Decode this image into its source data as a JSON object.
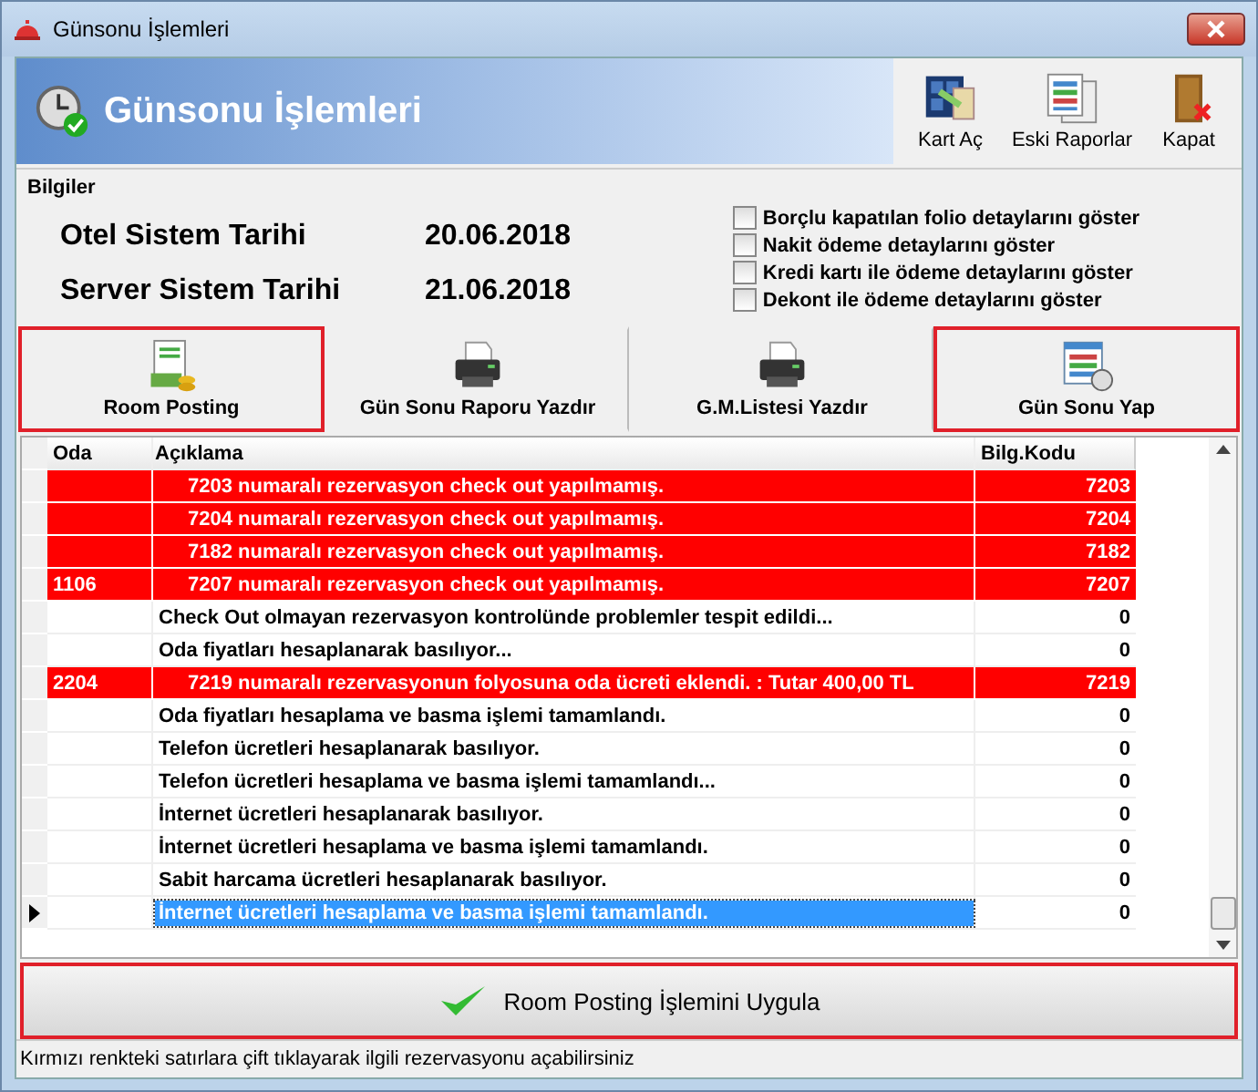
{
  "window": {
    "title": "Günsonu İşlemleri"
  },
  "header": {
    "title": "Günsonu İşlemleri",
    "tools": [
      {
        "kind": "card",
        "label": "Kart Aç"
      },
      {
        "kind": "reports",
        "label": "Eski Raporlar"
      },
      {
        "kind": "exit",
        "label": "Kapat"
      }
    ]
  },
  "info": {
    "title": "Bilgiler",
    "dates": [
      {
        "label": "Otel Sistem Tarihi",
        "value": "20.06.2018"
      },
      {
        "label": "Server Sistem Tarihi",
        "value": "21.06.2018"
      }
    ],
    "options": [
      {
        "label": "Borçlu kapatılan folio detaylarını göster",
        "checked": false
      },
      {
        "label": "Nakit ödeme detaylarını göster",
        "checked": false
      },
      {
        "label": "Kredi kartı ile ödeme detaylarını göster",
        "checked": false
      },
      {
        "label": "Dekont ile ödeme detaylarını göster",
        "checked": false
      }
    ]
  },
  "actions": [
    {
      "kind": "money",
      "label": "Room Posting",
      "highlighted": true
    },
    {
      "kind": "printer",
      "label": "Gün Sonu Raporu Yazdır",
      "highlighted": false
    },
    {
      "kind": "printer",
      "label": "G.M.Listesi Yazdır",
      "highlighted": false
    },
    {
      "kind": "schedule",
      "label": "Gün Sonu Yap",
      "highlighted": true
    }
  ],
  "table": {
    "columns": [
      "Oda",
      "Açıklama",
      "Bilg.Kodu"
    ],
    "rows": [
      {
        "room": "",
        "text": "7203 numaralı rezervasyon check out yapılmamış.",
        "code": "7203",
        "error": true,
        "selected": false
      },
      {
        "room": "",
        "text": "7204 numaralı rezervasyon check out yapılmamış.",
        "code": "7204",
        "error": true,
        "selected": false
      },
      {
        "room": "",
        "text": "7182 numaralı rezervasyon check out yapılmamış.",
        "code": "7182",
        "error": true,
        "selected": false
      },
      {
        "room": "1106",
        "text": "7207 numaralı rezervasyon check out yapılmamış.",
        "code": "7207",
        "error": true,
        "selected": false
      },
      {
        "room": "",
        "text": "Check Out olmayan rezervasyon kontrolünde problemler tespit edildi...",
        "code": "0",
        "error": false,
        "selected": false
      },
      {
        "room": "",
        "text": "Oda fiyatları hesaplanarak basılıyor...",
        "code": "0",
        "error": false,
        "selected": false
      },
      {
        "room": "2204",
        "text": "7219 numaralı rezervasyonun folyosuna oda ücreti eklendi. : Tutar 400,00 TL",
        "code": "7219",
        "error": true,
        "selected": false
      },
      {
        "room": "",
        "text": "Oda fiyatları hesaplama ve basma işlemi tamamlandı.",
        "code": "0",
        "error": false,
        "selected": false
      },
      {
        "room": "",
        "text": "Telefon ücretleri hesaplanarak basılıyor.",
        "code": "0",
        "error": false,
        "selected": false
      },
      {
        "room": "",
        "text": "Telefon ücretleri hesaplama ve basma işlemi tamamlandı...",
        "code": "0",
        "error": false,
        "selected": false
      },
      {
        "room": "",
        "text": "İnternet ücretleri hesaplanarak basılıyor.",
        "code": "0",
        "error": false,
        "selected": false
      },
      {
        "room": "",
        "text": "İnternet ücretleri hesaplama ve basma işlemi tamamlandı.",
        "code": "0",
        "error": false,
        "selected": false
      },
      {
        "room": "",
        "text": "Sabit harcama ücretleri hesaplanarak basılıyor.",
        "code": "0",
        "error": false,
        "selected": false
      },
      {
        "room": "",
        "text": "İnternet ücretleri hesaplama ve basma işlemi tamamlandı.",
        "code": "0",
        "error": false,
        "selected": true
      }
    ]
  },
  "apply_button": {
    "label": "Room Posting İşlemini Uygula",
    "highlighted": true
  },
  "status_bar": "Kırmızı renkteki satırlara çift tıklayarak ilgili rezervasyonu açabilirsiniz"
}
